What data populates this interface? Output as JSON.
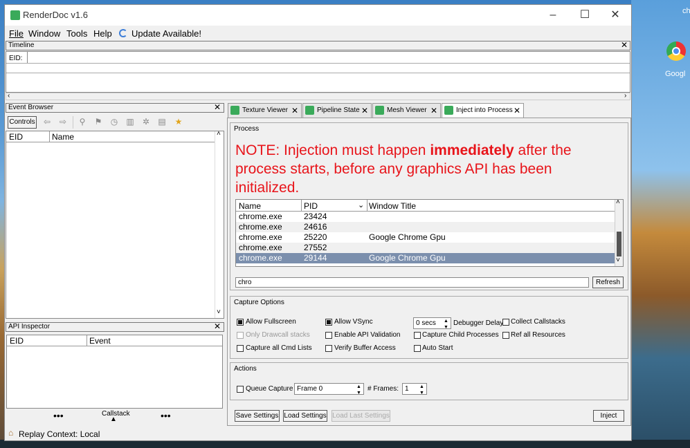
{
  "window": {
    "title": "RenderDoc v1.6",
    "controls": {
      "minimize": "–",
      "maximize": "☐",
      "close": "✕"
    }
  },
  "menu": {
    "file": "File",
    "window": "Window",
    "tools": "Tools",
    "help": "Help",
    "update": "Update Available!"
  },
  "timeline": {
    "title": "Timeline",
    "eid_label": "EID:"
  },
  "event_browser": {
    "title": "Event Browser",
    "controls_label": "Controls",
    "columns": [
      "EID",
      "Name"
    ]
  },
  "api_inspector": {
    "title": "API Inspector",
    "columns": [
      "EID",
      "Event"
    ],
    "callstack_label": "Callstack"
  },
  "status_bar": {
    "text": "Replay Context: Local"
  },
  "tabs": [
    {
      "label": "Texture Viewer"
    },
    {
      "label": "Pipeline State"
    },
    {
      "label": "Mesh Viewer"
    },
    {
      "label": "Inject into Process"
    }
  ],
  "inject": {
    "process_group": "Process",
    "note_prefix": "NOTE: Injection must happen ",
    "note_bold": "immediately",
    "note_suffix": " after the process starts, before any graphics API has been initialized.",
    "columns": {
      "name": "Name",
      "pid": "PID",
      "window_title": "Window Title"
    },
    "processes": [
      {
        "name": "chrome.exe",
        "pid": "23424",
        "title": ""
      },
      {
        "name": "chrome.exe",
        "pid": "24616",
        "title": ""
      },
      {
        "name": "chrome.exe",
        "pid": "25220",
        "title": "Google Chrome Gpu"
      },
      {
        "name": "chrome.exe",
        "pid": "27552",
        "title": ""
      },
      {
        "name": "chrome.exe",
        "pid": "29144",
        "title": "Google Chrome Gpu"
      }
    ],
    "filter_value": "chro",
    "refresh_label": "Refresh",
    "capture_options_title": "Capture Options",
    "options": {
      "allow_fullscreen": "Allow Fullscreen",
      "allow_vsync": "Allow VSync",
      "debugger_delay_value": "0 secs",
      "debugger_delay_label": "Debugger Delay",
      "collect_callstacks": "Collect Callstacks",
      "only_drawcall_stacks": "Only Drawcall stacks",
      "enable_api_validation": "Enable API Validation",
      "capture_child_processes": "Capture Child Processes",
      "ref_all_resources": "Ref all Resources",
      "capture_all_cmd_lists": "Capture all Cmd Lists",
      "verify_buffer_access": "Verify Buffer Access",
      "auto_start": "Auto Start"
    },
    "actions_title": "Actions",
    "queue_capture_label": "Queue Capture",
    "frame_value": "Frame 0",
    "frames_label": "# Frames:",
    "frames_value": "1",
    "save_settings": "Save Settings",
    "load_settings": "Load Settings",
    "load_last_settings": "Load Last Settings",
    "inject_label": "Inject"
  },
  "desktop": {
    "icon_label": "Googl",
    "edge_label": "ch"
  },
  "colors": {
    "note_red": "#e8141a",
    "selected_row": "#7b8fad",
    "app_green": "#3aaa5a"
  }
}
